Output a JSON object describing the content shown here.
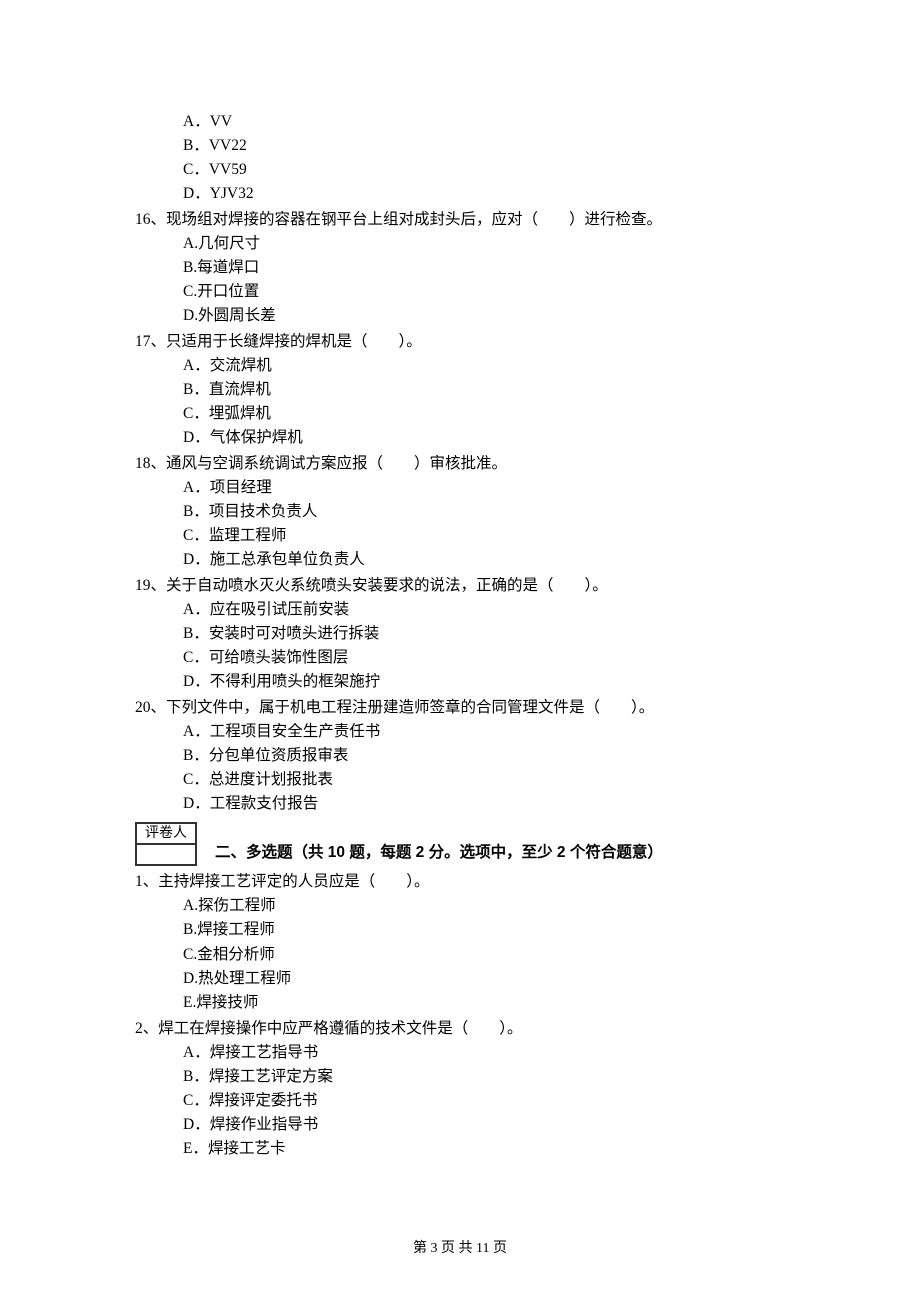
{
  "q15_options": {
    "A": "A．VV",
    "B": "B．VV22",
    "C": "C．VV59",
    "D": "D．YJV32"
  },
  "q16": {
    "stem": "16、现场组对焊接的容器在钢平台上组对成封头后，应对（　　）进行检查。",
    "A": "A.几何尺寸",
    "B": "B.每道焊口",
    "C": "C.开口位置",
    "D": "D.外圆周长差"
  },
  "q17": {
    "stem": "17、只适用于长缝焊接的焊机是（　　）。",
    "A": "A．交流焊机",
    "B": "B．直流焊机",
    "C": "C．埋弧焊机",
    "D": "D．气体保护焊机"
  },
  "q18": {
    "stem": "18、通风与空调系统调试方案应报（　　）审核批准。",
    "A": "A．项目经理",
    "B": "B．项目技术负责人",
    "C": "C．监理工程师",
    "D": "D．施工总承包单位负责人"
  },
  "q19": {
    "stem": "19、关于自动喷水灭火系统喷头安装要求的说法，正确的是（　　）。",
    "A": "A．应在吸引试压前安装",
    "B": "B．安装时可对喷头进行拆装",
    "C": "C．可给喷头装饰性图层",
    "D": "D．不得利用喷头的框架施拧"
  },
  "q20": {
    "stem": "20、下列文件中，属于机电工程注册建造师签章的合同管理文件是（　　）。",
    "A": "A．工程项目安全生产责任书",
    "B": "B．分包单位资质报审表",
    "C": "C．总进度计划报批表",
    "D": "D．工程款支付报告"
  },
  "grader_label": "评卷人",
  "section2_heading": "二、多选题（共 10 题，每题 2 分。选项中，至少 2 个符合题意）",
  "mq1": {
    "stem": "1、主持焊接工艺评定的人员应是（　　）。",
    "A": "A.探伤工程师",
    "B": "B.焊接工程师",
    "C": "C.金相分析师",
    "D": "D.热处理工程师",
    "E": "E.焊接技师"
  },
  "mq2": {
    "stem": "2、焊工在焊接操作中应严格遵循的技术文件是（　　）。",
    "A": "A．焊接工艺指导书",
    "B": "B．焊接工艺评定方案",
    "C": "C．焊接评定委托书",
    "D": "D．焊接作业指导书",
    "E": "E．焊接工艺卡"
  },
  "footer": "第 3 页 共 11 页"
}
